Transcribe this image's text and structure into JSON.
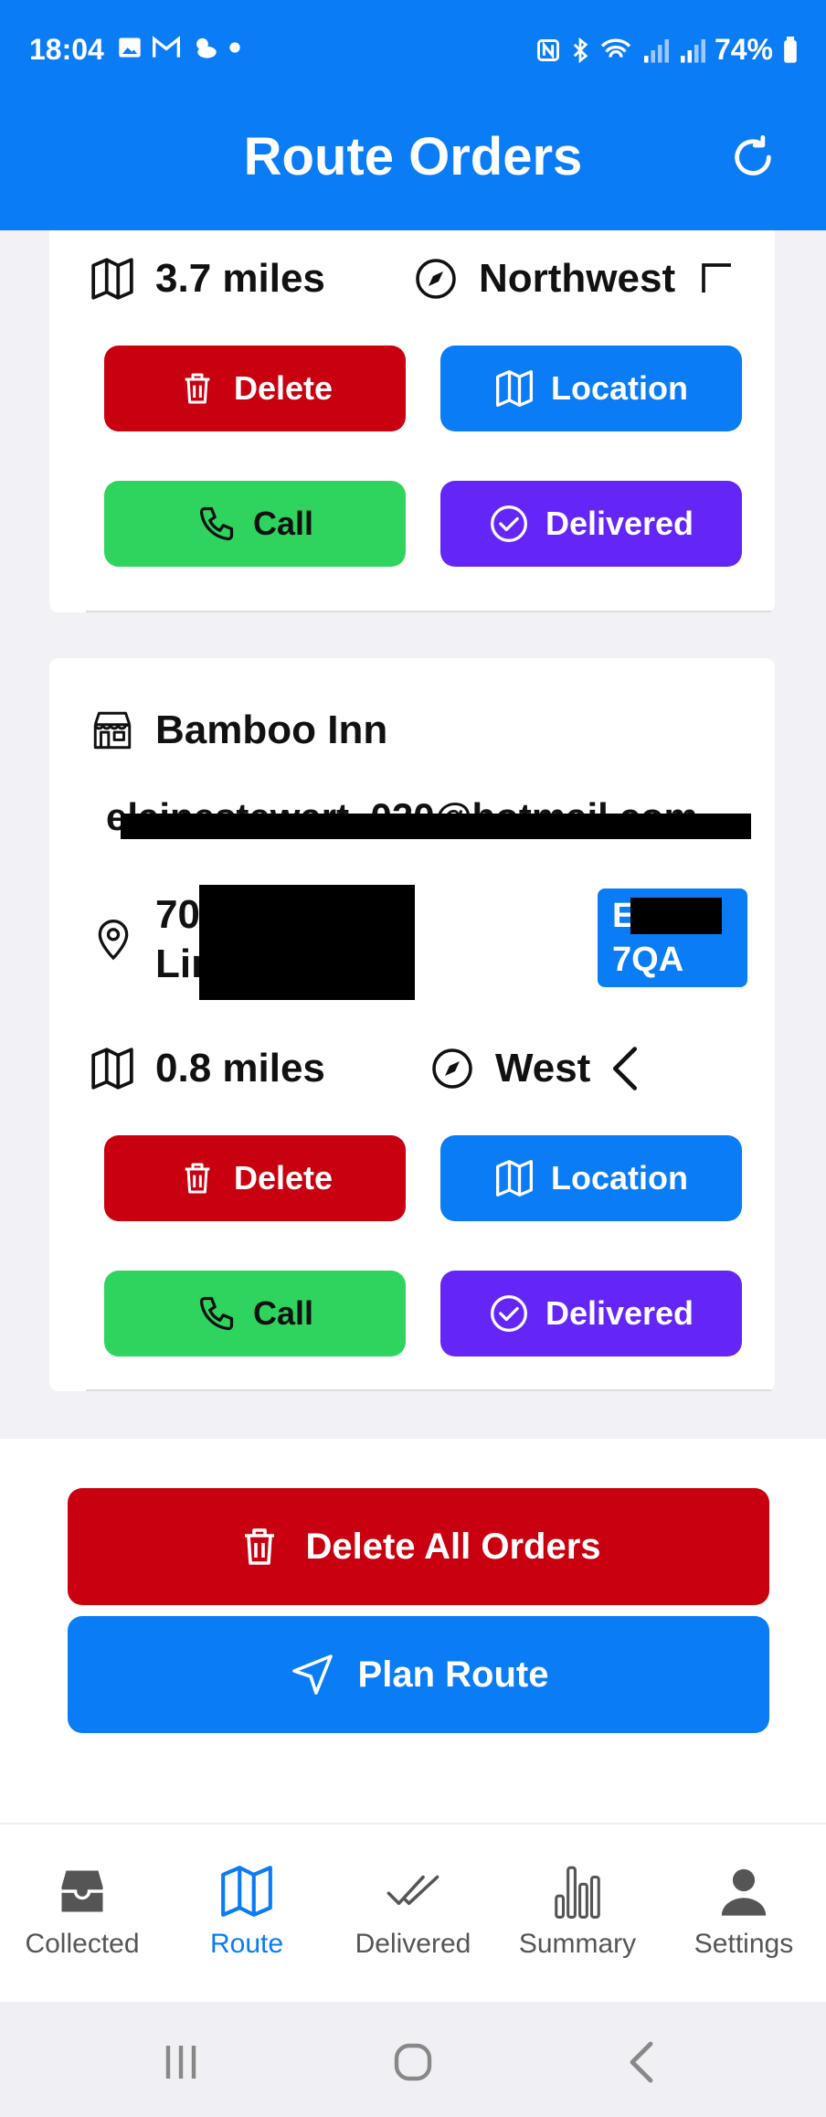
{
  "status_bar": {
    "time": "18:04",
    "battery": "74%"
  },
  "header": {
    "title": "Route Orders"
  },
  "orders": [
    {
      "distance": "3.7 miles",
      "direction": "Northwest",
      "buttons": {
        "delete": "Delete",
        "location": "Location",
        "call": "Call",
        "delivered": "Delivered"
      }
    },
    {
      "name": "Bamboo Inn",
      "email": "elainestewart_020@hotmail.com",
      "address_line1": "70 ",
      "address_line2": "Lin",
      "postcode_line1": "E",
      "postcode_line2": "7QA",
      "distance": "0.8 miles",
      "direction": "West",
      "buttons": {
        "delete": "Delete",
        "location": "Location",
        "call": "Call",
        "delivered": "Delivered"
      }
    }
  ],
  "actions": {
    "delete_all": "Delete All Orders",
    "plan_route": "Plan Route"
  },
  "tabs": [
    {
      "label": "Collected"
    },
    {
      "label": "Route"
    },
    {
      "label": "Delivered"
    },
    {
      "label": "Summary"
    },
    {
      "label": "Settings"
    }
  ],
  "colors": {
    "primary": "#0a7cf5",
    "danger": "#c9000f",
    "success": "#2fd45e",
    "delivered": "#6425f7"
  }
}
